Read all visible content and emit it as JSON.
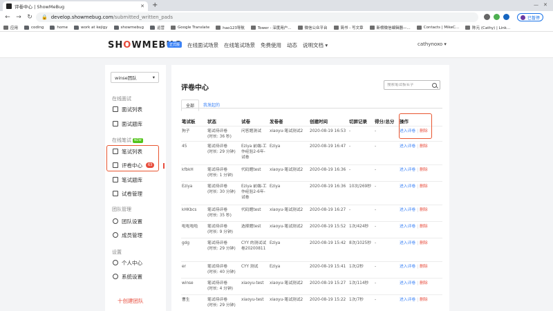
{
  "browser": {
    "tab_title": "评卷中心 | ShowMeBug",
    "url_host": "develop.showmebug.com",
    "url_path": "/submitted_written_pads",
    "profile_label": "已暂停"
  },
  "bookmarks": [
    {
      "label": "应用",
      "icon": "apps-icon"
    },
    {
      "label": "coding",
      "icon": "folder-icon"
    },
    {
      "label": "home",
      "icon": "folder-icon"
    },
    {
      "label": "work at kejigy",
      "icon": "folder-icon"
    },
    {
      "label": "showmebug",
      "icon": "folder-icon"
    },
    {
      "label": "运营",
      "icon": "folder-icon"
    },
    {
      "label": "Google Translate",
      "icon": "translate-icon"
    },
    {
      "label": "hao123导航",
      "icon": "site-icon"
    },
    {
      "label": "Tower - 深度用户...",
      "icon": "site-icon"
    },
    {
      "label": "微信公众平台",
      "icon": "site-icon"
    },
    {
      "label": "简书 - 写文章",
      "icon": "site-icon"
    },
    {
      "label": "新榜微信编辑器—...",
      "icon": "site-icon"
    },
    {
      "label": "Contacts | MikeC...",
      "icon": "site-icon"
    },
    {
      "label": "陈元 (Cathy) | Link...",
      "icon": "site-icon"
    }
  ],
  "header": {
    "logo_pre": "SH",
    "logo_o": "O",
    "logo_post": "WMEBUG",
    "badge": "正式版",
    "nav": [
      "在线面试场景",
      "在线笔试场景",
      "免费使用",
      "动态",
      "说明文档 ▾"
    ],
    "user": "cathynoxo ▾"
  },
  "sidebar": {
    "team": "winse团队",
    "groups": {
      "interview": "在线面试",
      "written": "在线笔试",
      "written_tag": "NEW",
      "team": "团队管理",
      "settings": "设置"
    },
    "items": {
      "interview_list": "面试列表",
      "interview_bank": "面试题库",
      "written_list": "笔试列表",
      "review_center": "评卷中心",
      "review_count": "63",
      "written_bank": "笔试题库",
      "paper_manage": "试卷管理",
      "team_settings": "团队设置",
      "member_manage": "成员管理",
      "personal_center": "个人中心",
      "system_settings": "系统设置"
    },
    "create_team": "十创建团队"
  },
  "main": {
    "title": "评卷中心",
    "search_placeholder": "搜索笔试板名字",
    "tabs": [
      "全部",
      "我发起的"
    ],
    "columns": [
      "笔试板",
      "状态",
      "试卷",
      "发卷者",
      "创建时间",
      "切屏记录",
      "得分/总分",
      "操作"
    ],
    "action_enter": "进入评卷",
    "action_delete": "删除",
    "rows": [
      {
        "name": "狗子",
        "status": "笔试待评卷",
        "duration": "(时长: 36 秒)",
        "paper": "问答题测试",
        "sender": "xiaoyu-笔试测试2",
        "time": "2020-08-19 16:53",
        "switch": "-",
        "score": "-",
        "size": "r1"
      },
      {
        "name": "45",
        "status": "笔试待评卷",
        "duration": "(时长: 29 分钟)",
        "paper": "Eziya 前端-工作经验2-6年-试卷",
        "sender": "Eziya",
        "time": "2020-08-19 16:47",
        "switch": "-",
        "score": "-",
        "size": "r2"
      },
      {
        "name": "kfbkH",
        "status": "笔试待评卷",
        "duration": "(时长: 1 分钟)",
        "paper": "代码题test",
        "sender": "xiaoyu-笔试测试2",
        "time": "2020-08-19 16:36",
        "switch": "-",
        "score": "-",
        "size": "r3"
      },
      {
        "name": "Eziya",
        "status": "笔试待评卷",
        "duration": "(时长: 30 分钟)",
        "paper": "Eziya 前端-工作经验2-6年-试卷",
        "sender": "Eziya",
        "time": "2020-08-19 16:36",
        "switch": "10次/269秒",
        "score": "-",
        "size": "r2"
      },
      {
        "name": "kHKbcs",
        "status": "笔试待评卷",
        "duration": "(时长: 35 秒)",
        "paper": "代码题test",
        "sender": "xiaoyu-笔试测试2",
        "time": "2020-08-19 16:27",
        "switch": "-",
        "score": "-",
        "size": "r3"
      },
      {
        "name": "啦啦啦啦",
        "status": "笔试待评卷",
        "duration": "(时长: 9 分钟)",
        "paper": "选择题test",
        "sender": "xiaoyu-笔试测试2",
        "time": "2020-08-19 15:52",
        "switch": "1次/424秒",
        "score": "-",
        "size": "r3"
      },
      {
        "name": "gdg",
        "status": "笔试待评卷",
        "duration": "(时长: 29 分钟)",
        "paper": "CYY 的测试试卷20200811",
        "sender": "Eziya",
        "time": "2020-08-19 15:42",
        "switch": "8次/1025秒",
        "score": "-",
        "size": "r2"
      },
      {
        "name": "er",
        "status": "笔试待评卷",
        "duration": "(时长: 40 分钟)",
        "paper": "CYY 测试",
        "sender": "Eziya",
        "time": "2020-08-19 15:41",
        "switch": "1次/2秒",
        "score": "-",
        "size": "r3"
      },
      {
        "name": "winse",
        "status": "笔试待评卷",
        "duration": "(时长: 4 分钟)",
        "paper": "xiaoyu-test",
        "sender": "xiaoyu-笔试测试2",
        "time": "2020-08-19 15:27",
        "switch": "1次/114秒",
        "score": "-",
        "size": "r3"
      },
      {
        "name": "曹生",
        "status": "笔试待评卷",
        "duration": "(时长: 29 分钟)",
        "paper": "xiaoyu-test",
        "sender": "xiaoyu-笔试测试2",
        "time": "2020-08-19 15:22",
        "switch": "1次/7秒",
        "score": "-",
        "size": "r3"
      }
    ]
  },
  "colors": {
    "accent": "#3b82f6",
    "danger": "#e74c3c",
    "highlight": "#e8542e"
  }
}
